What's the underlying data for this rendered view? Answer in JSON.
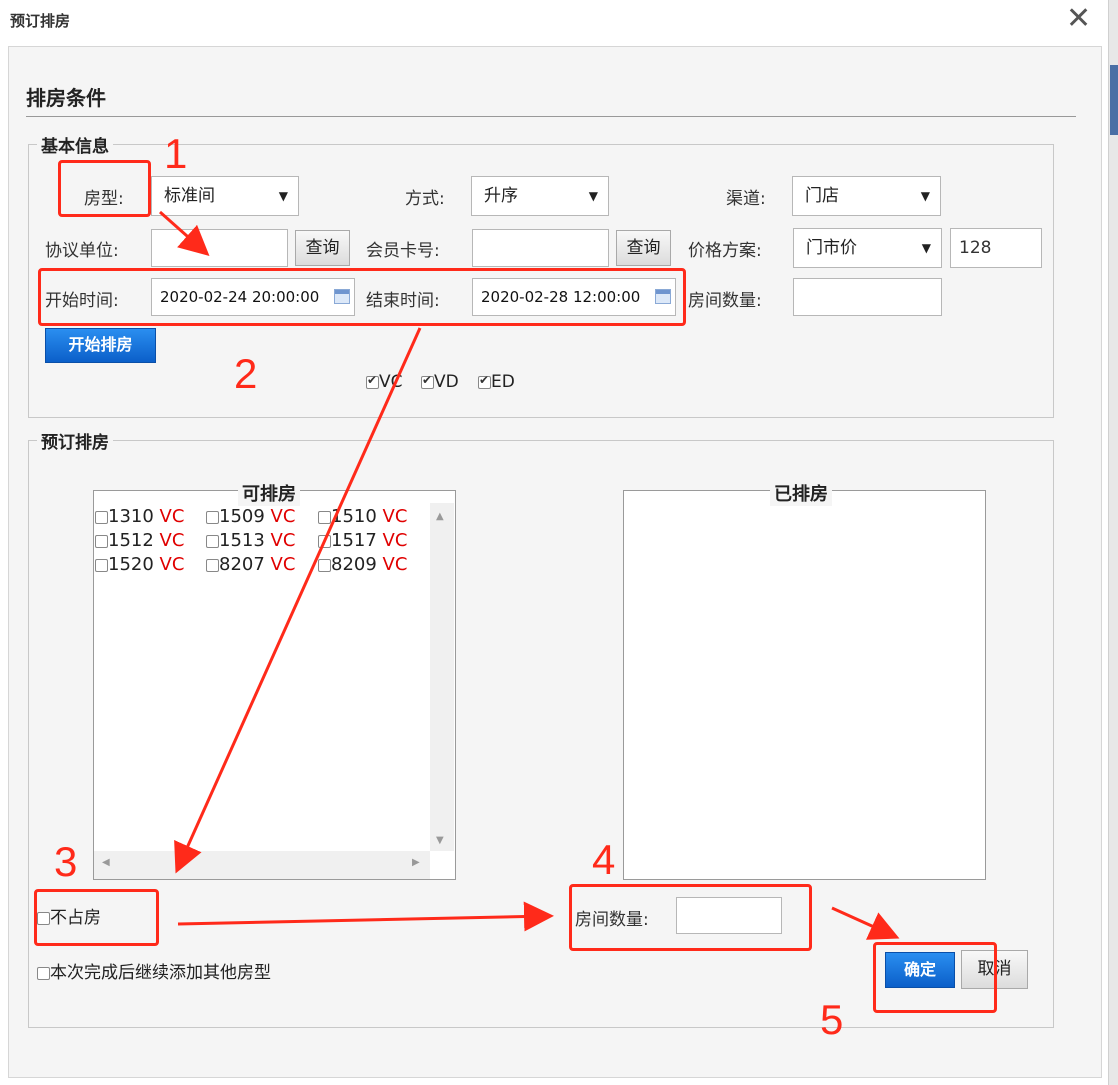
{
  "dialog": {
    "title": "预订排房",
    "close_glyph": "✕"
  },
  "section": {
    "title": "排房条件"
  },
  "basic": {
    "legend": "基本信息",
    "room_type_label": "房型:",
    "room_type_value": "标准间",
    "method_label": "方式:",
    "method_value": "升序",
    "channel_label": "渠道:",
    "channel_value": "门店",
    "agreement_label": "协议单位:",
    "agreement_value": "",
    "query_label": "查询",
    "member_label": "会员卡号:",
    "member_value": "",
    "price_plan_label": "价格方案:",
    "price_plan_value": "门市价",
    "price_value": "128",
    "start_label": "开始时间:",
    "start_value": "2020-02-24 20:00:00",
    "end_label": "结束时间:",
    "end_value": "2020-02-28 12:00:00",
    "room_count_label": "房间数量:",
    "room_count_value": "",
    "start_button": "开始排房",
    "filters": [
      {
        "label": "VC",
        "checked": true
      },
      {
        "label": "VD",
        "checked": true
      },
      {
        "label": "ED",
        "checked": true
      }
    ]
  },
  "booking": {
    "legend": "预订排房",
    "available_title": "可排房",
    "assigned_title": "已排房",
    "rooms": [
      {
        "number": "1310",
        "status": "VC"
      },
      {
        "number": "1509",
        "status": "VC"
      },
      {
        "number": "1510",
        "status": "VC"
      },
      {
        "number": "1512",
        "status": "VC"
      },
      {
        "number": "1513",
        "status": "VC"
      },
      {
        "number": "1517",
        "status": "VC"
      },
      {
        "number": "1520",
        "status": "VC"
      },
      {
        "number": "8207",
        "status": "VC"
      },
      {
        "number": "8209",
        "status": "VC"
      }
    ],
    "no_occupy_label": "不占房",
    "continue_label": "本次完成后继续添加其他房型",
    "room_count_label": "房间数量:",
    "room_count_value": "",
    "confirm_label": "确定",
    "cancel_label": "取消"
  },
  "annotations": {
    "n1": "1",
    "n2": "2",
    "n3": "3",
    "n4": "4",
    "n5": "5",
    "color": "#ff2a1a"
  },
  "icons": [
    "close-icon",
    "dropdown-arrow-icon",
    "calendar-icon",
    "scroll-arrow-icon",
    "checkbox-icon"
  ]
}
